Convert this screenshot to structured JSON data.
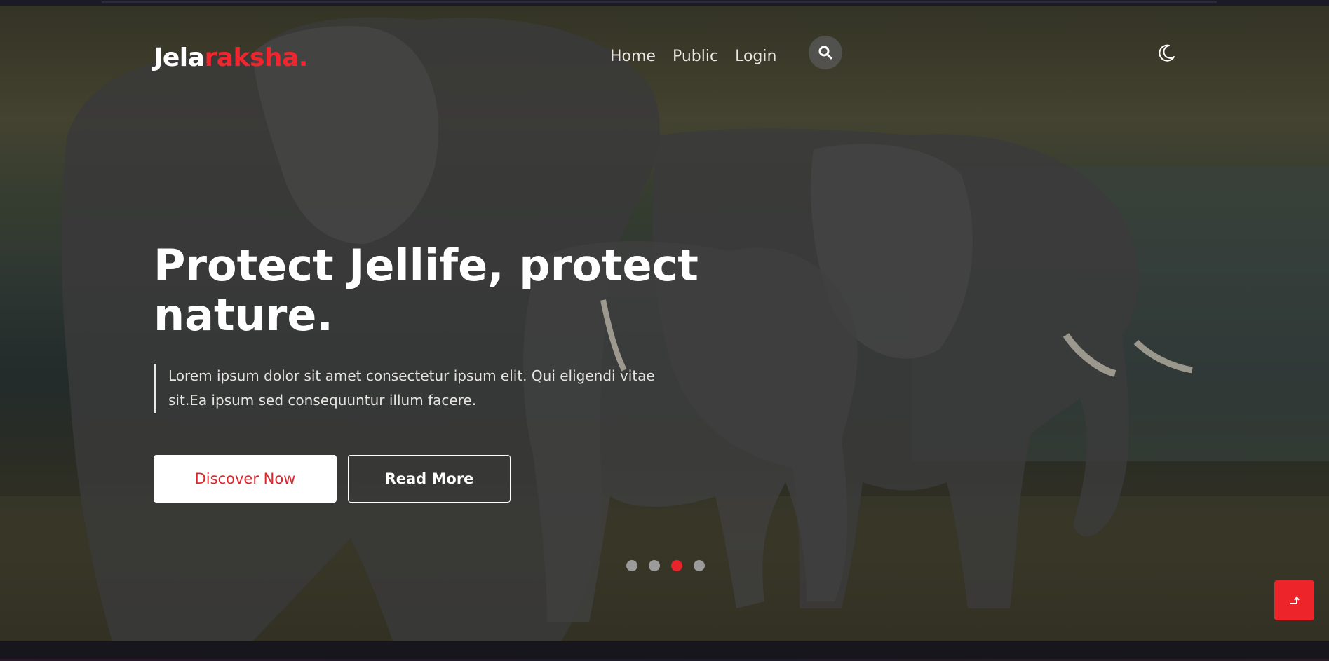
{
  "header": {
    "logo_main": "Jela",
    "logo_accent": "raksha.",
    "nav": [
      "Home",
      "Public",
      "Login"
    ],
    "search_icon": "search-icon",
    "theme_icon": "moon-icon"
  },
  "hero": {
    "headline_line1": "Protect Jellife, protect",
    "headline_line2": "nature.",
    "lead_line1": "Lorem ipsum dolor sit amet consectetur ipsum elit. Qui eligendi vitae",
    "lead_line2": "sit.Ea ipsum sed consequuntur illum facere.",
    "primary_button": "Discover Now",
    "secondary_button": "Read More",
    "slides_total": 4,
    "active_slide": 3
  },
  "scroll_top_icon": "arrow-up-icon",
  "colors": {
    "accent": "#f0262e",
    "text": "#ffffff",
    "dot_inactive": "#9b9b9b"
  }
}
